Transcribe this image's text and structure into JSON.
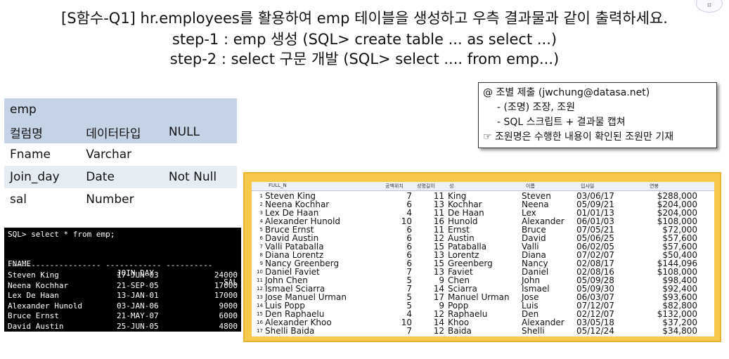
{
  "header": {
    "line1": "[S함수-Q1] hr.employees를 활용하여 emp 테이블을 생성하고 우측 결과물과 같이 출력하세요.",
    "line2": "step-1 : emp 생성 (SQL> create table ... as select ...)",
    "line3": "step-2 : select 구문 개발 (SQL> select .... from emp...)"
  },
  "note": {
    "line1": "@ 조별 제출 (jwchung@datasa.net)",
    "line2": "-   (조명)  조장, 조원",
    "line3": "- SQL 스크립트 + 결과물 캡쳐",
    "line4": "☞ 조원명은 수행한 내용이 확인된 조원만 기재"
  },
  "schema": {
    "table_name": "emp",
    "headers": [
      "컬럼명",
      "데이터타입",
      "NULL"
    ],
    "rows": [
      [
        "Fname",
        "Varchar",
        ""
      ],
      [
        "Join_day",
        "Date",
        "Not Null"
      ],
      [
        "sal",
        "Number",
        ""
      ]
    ]
  },
  "console": {
    "command": "SQL> select * from emp;",
    "headers": [
      "FNAME",
      "JOIN_DAY",
      "SAL"
    ],
    "separator": "-------------------- ------------ ----------",
    "rows": [
      [
        "Steven King",
        "17-JUN-03",
        "24000"
      ],
      [
        "Neena Kochhar",
        "21-SEP-05",
        "17000"
      ],
      [
        "Lex De Haan",
        "13-JAN-01",
        "17000"
      ],
      [
        "Alexander Hunold",
        "03-JAN-06",
        "9000"
      ],
      [
        "Bruce Ernst",
        "21-MAY-07",
        "6000"
      ],
      [
        "David Austin",
        "25-JUN-05",
        "4800"
      ]
    ]
  },
  "result_grid": {
    "headers": [
      "FULL_N",
      "공백위치",
      "성명길이",
      "성",
      "이름",
      "입사일",
      "연봉"
    ],
    "rows": [
      [
        "1",
        "Steven King",
        "7",
        "11",
        "King",
        "Steven",
        "03/06/17",
        "$288,000"
      ],
      [
        "2",
        "Neena Kochhar",
        "6",
        "13",
        "Kochhar",
        "Neena",
        "05/09/21",
        "$204,000"
      ],
      [
        "3",
        "Lex De Haan",
        "4",
        "11",
        "De Haan",
        "Lex",
        "01/01/13",
        "$204,000"
      ],
      [
        "4",
        "Alexander Hunold",
        "10",
        "16",
        "Hunold",
        "Alexander",
        "06/01/03",
        "$108,000"
      ],
      [
        "5",
        "Bruce Ernst",
        "6",
        "11",
        "Ernst",
        "Bruce",
        "07/05/21",
        "$72,000"
      ],
      [
        "6",
        "David Austin",
        "6",
        "12",
        "Austin",
        "David",
        "05/06/25",
        "$57,600"
      ],
      [
        "7",
        "Valli Pataballa",
        "6",
        "15",
        "Pataballa",
        "Valli",
        "06/02/05",
        "$57,600"
      ],
      [
        "8",
        "Diana Lorentz",
        "6",
        "13",
        "Lorentz",
        "Diana",
        "07/02/07",
        "$50,400"
      ],
      [
        "9",
        "Nancy Greenberg",
        "6",
        "15",
        "Greenberg",
        "Nancy",
        "02/08/17",
        "$144,096"
      ],
      [
        "10",
        "Daniel Faviet",
        "7",
        "13",
        "Faviet",
        "Daniel",
        "02/08/16",
        "$108,000"
      ],
      [
        "11",
        "John Chen",
        "5",
        "9",
        "Chen",
        "John",
        "05/09/28",
        "$98,400"
      ],
      [
        "12",
        "Ismael Sciarra",
        "7",
        "14",
        "Sciarra",
        "Ismael",
        "05/09/30",
        "$92,400"
      ],
      [
        "13",
        "Jose Manuel Urman",
        "5",
        "17",
        "Manuel Urman",
        "Jose",
        "06/03/07",
        "$93,600"
      ],
      [
        "14",
        "Luis Popp",
        "5",
        "9",
        "Popp",
        "Luis",
        "07/12/07",
        "$82,800"
      ],
      [
        "15",
        "Den Raphaelu",
        "4",
        "12",
        "Raphaelu",
        "Den",
        "02/12/07",
        "$132,000"
      ],
      [
        "16",
        "Alexander Khoo",
        "10",
        "14",
        "Khoo",
        "Alexander",
        "03/05/18",
        "$37,200"
      ],
      [
        "17",
        "Shelli Baida",
        "7",
        "12",
        "Baida",
        "Shelli",
        "05/12/24",
        "$34,800"
      ]
    ]
  }
}
